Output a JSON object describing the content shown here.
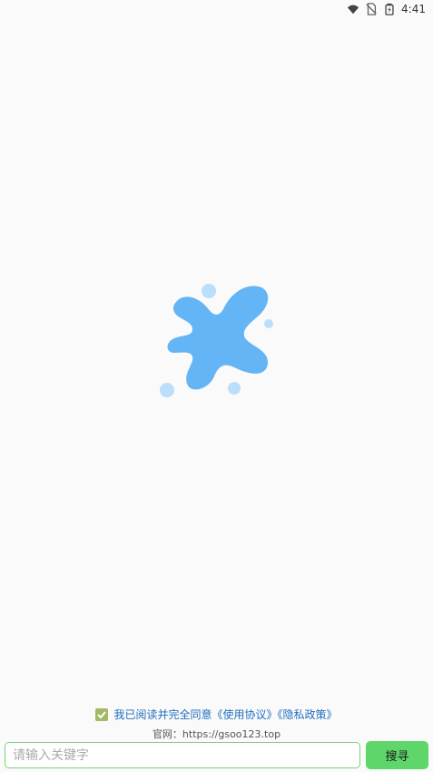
{
  "status_bar": {
    "time": "4:41",
    "icons": [
      "wifi-icon",
      "no-sim-icon",
      "battery-icon"
    ]
  },
  "logo": {
    "icon": "splash-logo-icon",
    "color": "#64b5f6",
    "bubble_color": "#bbdefb"
  },
  "agreement": {
    "checked": true,
    "text": "我已阅读并完全同意《使用协议》《隐私政策》"
  },
  "website": {
    "text": "官网：https://gsoo123.top"
  },
  "search": {
    "placeholder": "请输入关键字",
    "value": "",
    "button_label": "搜寻"
  },
  "colors": {
    "background": "#fafafa",
    "accent_green": "#5fd66a",
    "input_border": "#7ed07a",
    "link_blue": "#1f6fbf",
    "checkbox": "#a3b865"
  }
}
